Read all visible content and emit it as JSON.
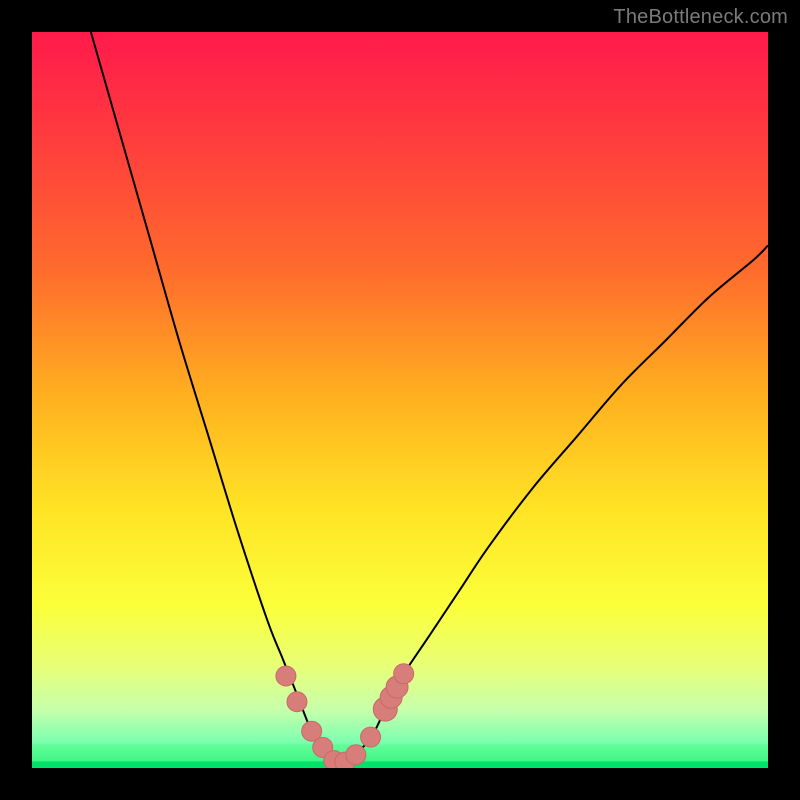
{
  "watermark": "TheBottleneck.com",
  "colors": {
    "frame": "#000000",
    "curve": "#000000",
    "marker_fill": "#d77d7a",
    "marker_stroke": "#c86a67",
    "good_band": "#59ff8c",
    "good_core": "#00e36a",
    "gradient_stops": [
      {
        "offset": 0.0,
        "color": "#ff1a4b"
      },
      {
        "offset": 0.15,
        "color": "#ff3d3d"
      },
      {
        "offset": 0.32,
        "color": "#ff6a2d"
      },
      {
        "offset": 0.5,
        "color": "#ffb21f"
      },
      {
        "offset": 0.65,
        "color": "#ffe425"
      },
      {
        "offset": 0.78,
        "color": "#fbff3a"
      },
      {
        "offset": 0.86,
        "color": "#e8ff76"
      },
      {
        "offset": 0.92,
        "color": "#c8ffab"
      },
      {
        "offset": 0.965,
        "color": "#7bffb0"
      },
      {
        "offset": 1.0,
        "color": "#00e36a"
      }
    ]
  },
  "chart_data": {
    "type": "line",
    "title": "",
    "xlabel": "",
    "ylabel": "",
    "xlim": [
      0,
      100
    ],
    "ylim": [
      0,
      100
    ],
    "x_opt": 42,
    "series": [
      {
        "name": "bottleneck-curve",
        "x": [
          0,
          4,
          8,
          12,
          16,
          20,
          24,
          28,
          32,
          34,
          36,
          38,
          40,
          41,
          42,
          43,
          44,
          46,
          48,
          50,
          54,
          58,
          62,
          68,
          74,
          80,
          86,
          92,
          98,
          100
        ],
        "values": [
          128,
          114,
          100,
          86,
          72,
          58,
          45,
          32,
          20,
          15,
          10,
          5,
          2,
          1,
          0.5,
          1,
          2,
          4,
          8,
          12,
          18,
          24,
          30,
          38,
          45,
          52,
          58,
          64,
          69,
          71
        ]
      }
    ],
    "markers": {
      "name": "highlighted-points",
      "x": [
        34.5,
        36.0,
        38.0,
        39.5,
        41.0,
        42.5,
        44.0,
        46.0,
        48.0,
        48.8,
        49.6,
        50.5
      ],
      "values": [
        12.5,
        9.0,
        5.0,
        2.8,
        1.0,
        0.8,
        1.8,
        4.2,
        8.0,
        9.6,
        11.0,
        12.8
      ],
      "r": [
        10,
        10,
        10,
        10,
        10,
        10,
        10,
        10,
        12,
        11,
        11,
        10
      ]
    }
  }
}
